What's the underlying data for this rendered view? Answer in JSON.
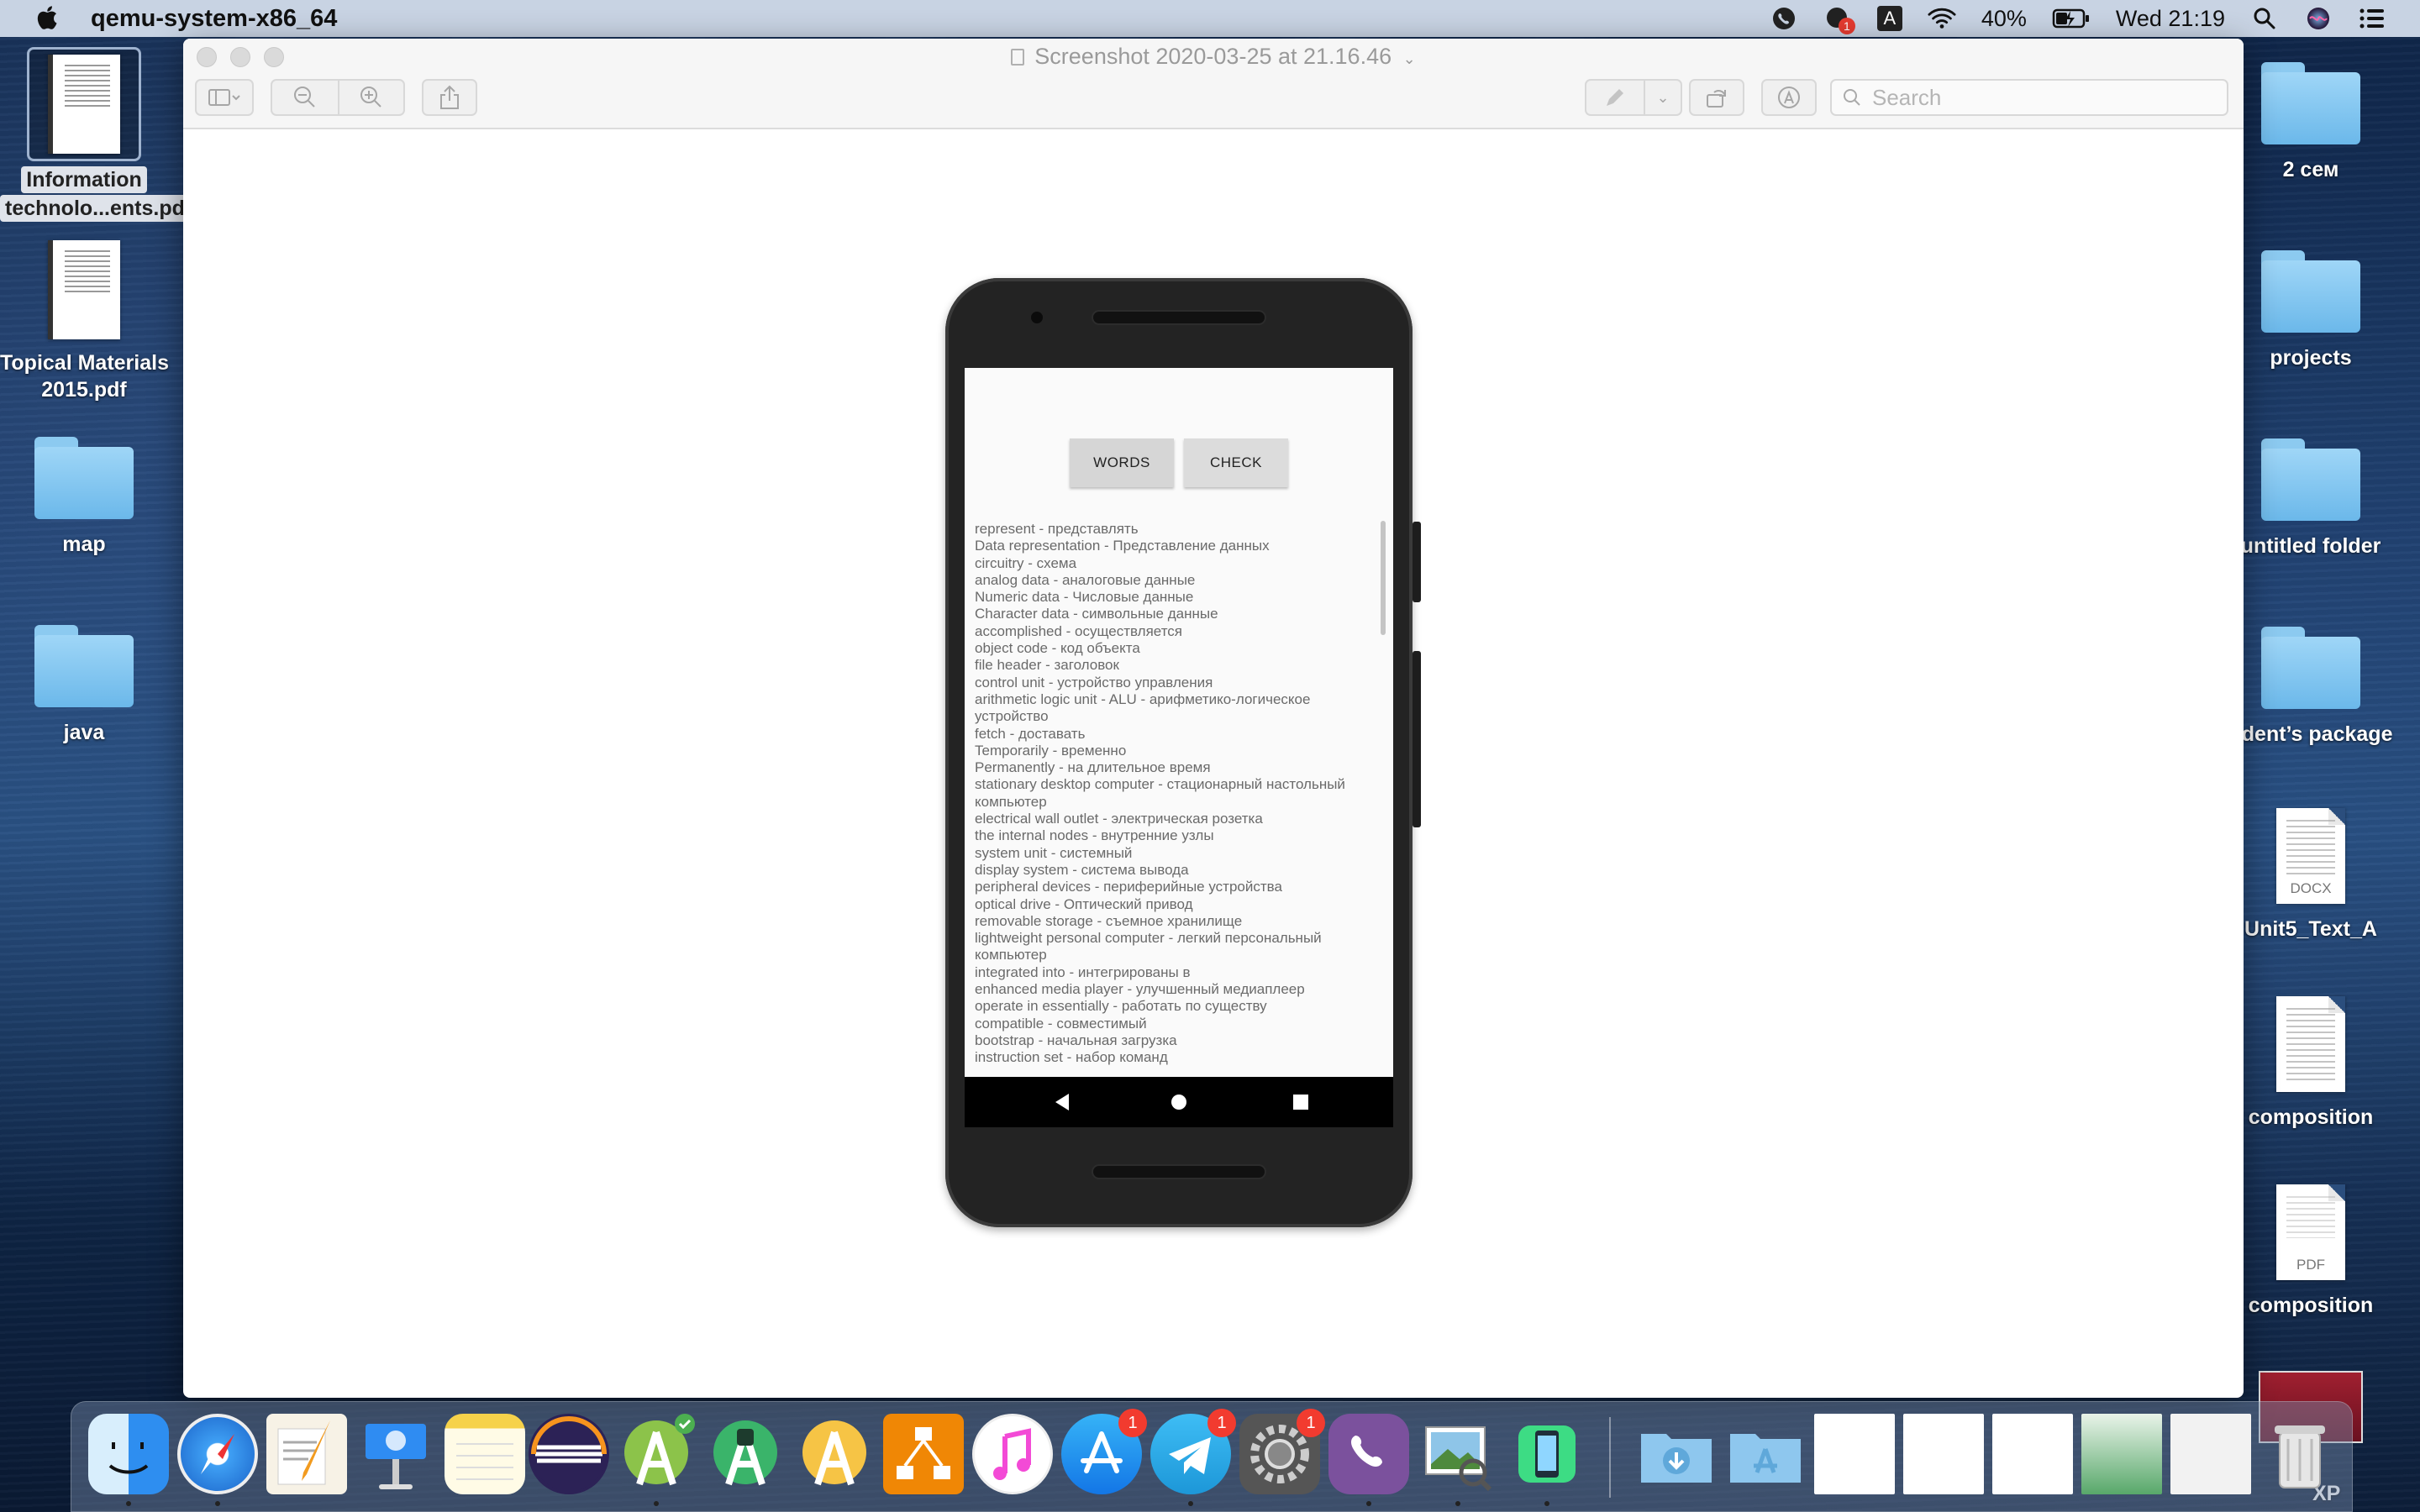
{
  "menubar": {
    "app_name": "qemu-system-x86_64",
    "status_icons": [
      "viber-status-icon",
      "notification-badge-icon",
      "input-source-icon",
      "wifi-icon"
    ],
    "notification_count": "1",
    "input_source": "A",
    "battery_percent": "40%",
    "clock": "Wed 21:19"
  },
  "window": {
    "title": "Screenshot 2020-03-25 at 21.16.46",
    "search_placeholder": "Search",
    "toolbar_icons": [
      "sidebar-icon",
      "zoom-out-icon",
      "zoom-in-icon",
      "share-icon",
      "markup-pen-icon",
      "rotate-icon",
      "annotate-icon"
    ]
  },
  "phone_app": {
    "buttons": {
      "words": "WORDS",
      "check": "CHECK"
    },
    "words": [
      "represent - представлять",
      " Data representation - Представление данных",
      " circuitry - схема",
      " analog data - аналоговые данные",
      " Numeric data - Числовые данные",
      " Character data - символьные данные",
      " accomplished - осуществляется",
      " object code - код объекта",
      " file header - заголовок",
      " control unit - устройство управления",
      " arithmetic logic unit - ALU - арифметико-логическое устройство",
      " fetch - доставать",
      " Temporarily - временно",
      " Permanently - на длительное время",
      " stationary desktop computer - стационарный настольный компьютер",
      " electrical wall outlet - электрическая розетка",
      " the internal nodes - внутренние узлы",
      " system unit - системный",
      " display system - система вывода",
      " peripheral devices - периферийные устройства",
      " optical drive - Оптический привод",
      " removable storage - съемное хранилище",
      " lightweight personal computer - легкий персональный компьютер",
      " integrated into - интегрированы в",
      " enhanced media player - улучшенный медиаплеер",
      " operate in essentially - работать по существу",
      " compatible - совместимый",
      " bootstrap - начальная загрузка",
      " instruction set - набор команд"
    ]
  },
  "desktop_left": [
    {
      "label1": "Information",
      "label2": "technolo...ents.pdf",
      "type": "pdf"
    },
    {
      "label1": "Topical Materials",
      "label2": "2015.pdf",
      "type": "pdf"
    },
    {
      "label1": "map",
      "label2": "",
      "type": "folder"
    },
    {
      "label1": "java",
      "label2": "",
      "type": "folder"
    }
  ],
  "desktop_right": [
    {
      "label": "2 сем",
      "type": "folder"
    },
    {
      "label": "projects",
      "type": "folder"
    },
    {
      "label": "untitled folder",
      "type": "folder"
    },
    {
      "label": "udent’s package",
      "type": "folder"
    },
    {
      "label": "Unit5_Text_A",
      "type": "docx",
      "ext": "DOCX"
    },
    {
      "label": "composition",
      "type": "doc",
      "ext": ""
    },
    {
      "label": "composition",
      "type": "pdf",
      "ext": "PDF"
    },
    {
      "label": "XP",
      "type": "image"
    }
  ],
  "dock": {
    "apps": [
      "finder-icon",
      "safari-icon",
      "pages-icon",
      "keynote-icon",
      "notes-icon",
      "eclipse-icon",
      "android-studio-icon",
      "android-studio-icon-2",
      "android-studio-icon-3",
      "draw-io-icon",
      "music-icon",
      "app-store-icon",
      "telegram-icon",
      "system-preferences-icon",
      "viber-icon",
      "preview-icon",
      "android-emulator-icon"
    ],
    "badges": {
      "app-store": "1",
      "telegram": "1",
      "system-preferences": "1"
    },
    "colors": {
      "accent_red": "#f23b2f",
      "folder_blue": "#7cc3ef"
    }
  }
}
